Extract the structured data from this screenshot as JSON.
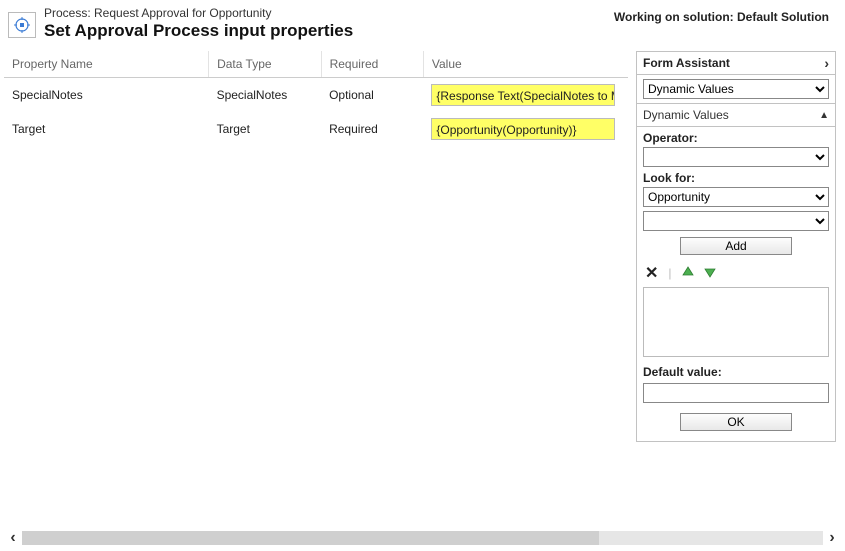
{
  "header": {
    "process_prefix": "Process: ",
    "process_name": "Request Approval for Opportunity",
    "title": "Set Approval Process input properties",
    "solution_prefix": "Working on solution: ",
    "solution_name": "Default Solution"
  },
  "columns": {
    "name": "Property Name",
    "type": "Data Type",
    "required": "Required",
    "value": "Value"
  },
  "rows": [
    {
      "name": "SpecialNotes",
      "type": "SpecialNotes",
      "required": "Optional",
      "value": "{Response Text(SpecialNotes to Manage"
    },
    {
      "name": "Target",
      "type": "Target",
      "required": "Required",
      "value": "{Opportunity(Opportunity)}"
    }
  ],
  "assistant": {
    "title": "Form Assistant",
    "dropdown_main": "Dynamic Values",
    "section_title": "Dynamic Values",
    "operator_label": "Operator:",
    "operator_value": "",
    "lookfor_label": "Look for:",
    "lookfor_value": "Opportunity",
    "lookfor_field_value": "",
    "add_label": "Add",
    "default_label": "Default value:",
    "ok_label": "OK"
  }
}
